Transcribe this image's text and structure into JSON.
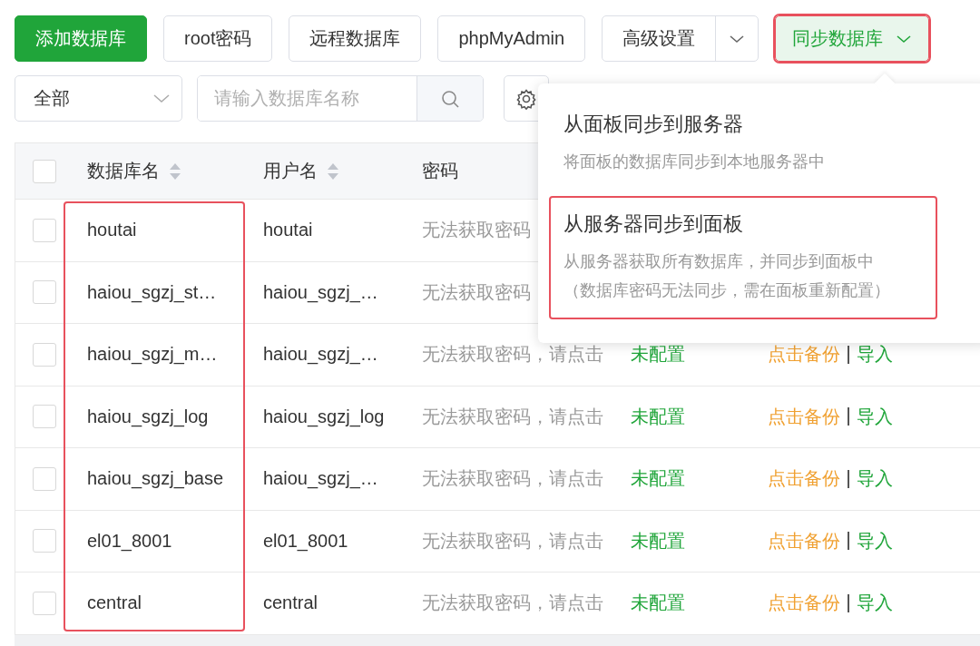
{
  "toolbar": {
    "buttons": [
      {
        "label": "添加数据库",
        "kind": "primary"
      },
      {
        "label": "root密码",
        "kind": "plain"
      },
      {
        "label": "远程数据库",
        "kind": "plain"
      },
      {
        "label": "phpMyAdmin",
        "kind": "plain"
      },
      {
        "label": "高级设置",
        "kind": "split"
      },
      {
        "label": "同步数据库",
        "kind": "dropdown",
        "highlighted": true,
        "expanded": true
      }
    ]
  },
  "filter": {
    "select": "全部",
    "search": {
      "placeholder": "请输入数据库名称"
    }
  },
  "table": {
    "name_column_highlighted": true,
    "header_checked": false,
    "columns": [
      {
        "label": "数据库名",
        "sortable": true
      },
      {
        "label": "用户名",
        "sortable": true
      },
      {
        "label": "密码",
        "sortable": false
      }
    ],
    "rows": [
      {
        "checked": false,
        "name": "houtai",
        "user": "houtai",
        "password": "无法获取密码"
      },
      {
        "checked": false,
        "name": "haiou_sgzj_st…",
        "user": "haiou_sgzj_…",
        "password": "无法获取密码"
      },
      {
        "checked": false,
        "name": "haiou_sgzj_m…",
        "user": "haiou_sgzj_…",
        "password": "无法获取密码，请点击",
        "status": "未配置",
        "backup": "点击备份",
        "import": "导入"
      },
      {
        "checked": false,
        "name": "haiou_sgzj_log",
        "user": "haiou_sgzj_log",
        "password": "无法获取密码，请点击",
        "status": "未配置",
        "backup": "点击备份",
        "import": "导入"
      },
      {
        "checked": false,
        "name": "haiou_sgzj_base",
        "user": "haiou_sgzj_…",
        "password": "无法获取密码，请点击",
        "status": "未配置",
        "backup": "点击备份",
        "import": "导入"
      },
      {
        "checked": false,
        "name": "el01_8001",
        "user": "el01_8001",
        "password": "无法获取密码，请点击",
        "status": "未配置",
        "backup": "点击备份",
        "import": "导入"
      },
      {
        "checked": false,
        "name": "central",
        "user": "central",
        "password": "无法获取密码，请点击",
        "status": "未配置",
        "backup": "点击备份",
        "import": "导入"
      }
    ]
  },
  "sync_menu": {
    "items": [
      {
        "title": "从面板同步到服务器",
        "description": [
          "将面板的数据库同步到本地服务器中"
        ],
        "highlighted": false
      },
      {
        "title": "从服务器同步到面板",
        "description": [
          "从服务器获取所有数据库，并同步到面板中",
          "（数据库密码无法同步，需在面板重新配置）"
        ],
        "highlighted": true
      }
    ]
  }
}
